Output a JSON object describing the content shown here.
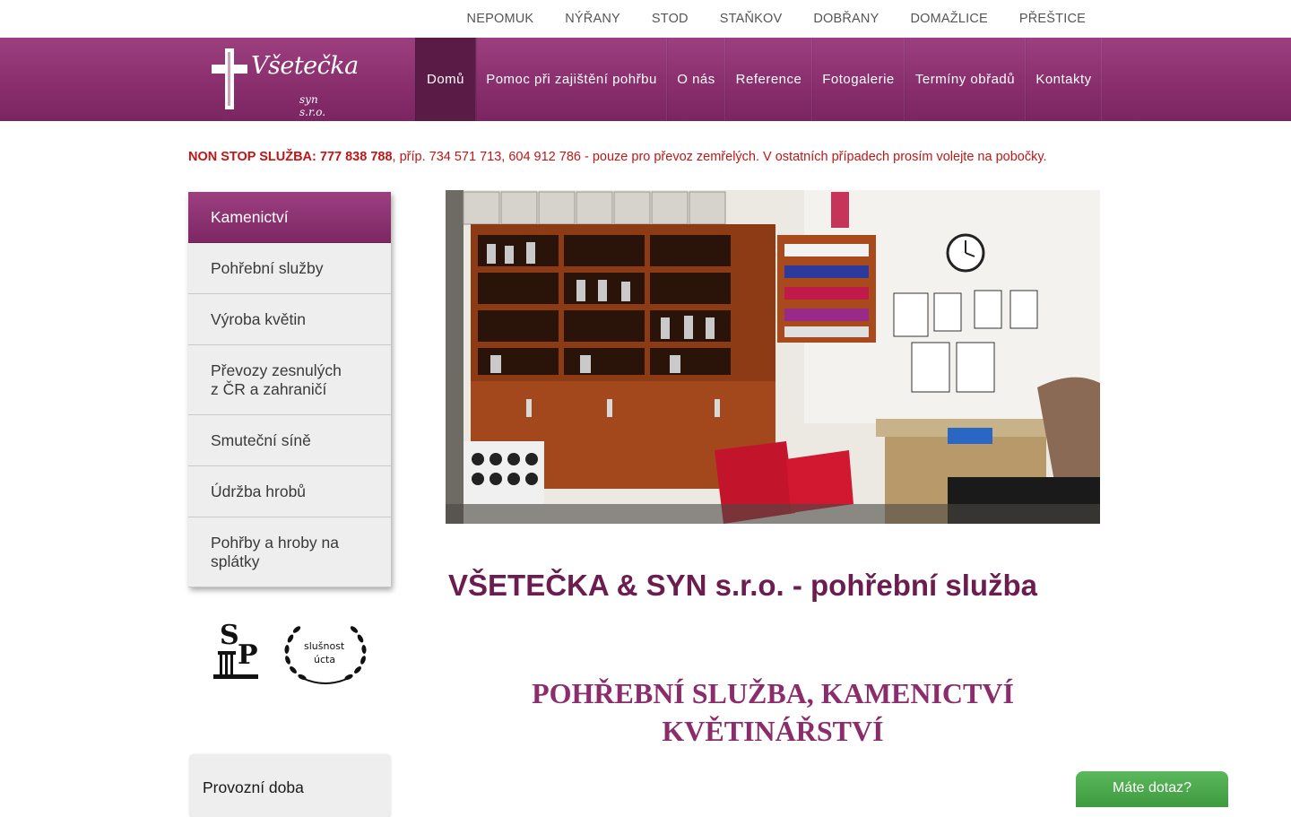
{
  "topnav": [
    "NEPOMUK",
    "NÝŘANY",
    "STOD",
    "STAŇKOV",
    "DOBŘANY",
    "DOMAŽLICE",
    "PŘEŠTICE"
  ],
  "logo": {
    "name": "Všetečka",
    "sub": "syn s.r.o."
  },
  "mainnav": [
    {
      "label": "Domů",
      "active": true
    },
    {
      "label": "Pomoc při zajištění pohřbu"
    },
    {
      "label": "O nás"
    },
    {
      "label": "Reference"
    },
    {
      "label": "Fotogalerie"
    },
    {
      "label": "Termíny obřadů"
    },
    {
      "label": "Kontakty"
    }
  ],
  "nonstop": {
    "bold": "NON STOP SLUŽBA: 777 838 788",
    "rest": ", příp. 734 571 713, 604 912 786 - pouze pro převoz zemřelých. V ostatních případech prosím volejte na pobočky."
  },
  "sidenav": [
    {
      "label": "Kamenictví",
      "active": true
    },
    {
      "label": "Pohřební služby"
    },
    {
      "label": "Výroba květin"
    },
    {
      "label": "Převozy zesnulých\nz ČR a zahraničí"
    },
    {
      "label": "Smuteční síně"
    },
    {
      "label": "Údržba hrobů"
    },
    {
      "label": "Pohřby a hroby na splátky"
    }
  ],
  "badges": {
    "sp": "SP",
    "wreath_line1": "slušnost",
    "wreath_line2": "úcta"
  },
  "provoz": "Provozní doba",
  "main": {
    "title": "VŠETEČKA & SYN s.r.o. - pohřební služba",
    "subtitle_line1": "POHŘEBNÍ SLUŽBA, KAMENICTVÍ",
    "subtitle_line2": "KVĚTINÁŘSTVÍ"
  },
  "chat": "Máte dotaz?",
  "colors": {
    "brand": "#8a2f6e",
    "brand_dark": "#5b1b47",
    "alert": "#c01616",
    "chat": "#4aa84a"
  }
}
